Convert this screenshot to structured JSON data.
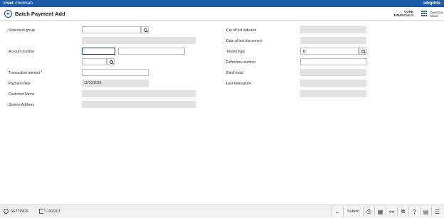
{
  "topbar": {
    "user_prefix": "User",
    "user_name": "cholman",
    "brand": "ubtpbta"
  },
  "header": {
    "title": "Batch Payment Add",
    "core_line1": "CORE",
    "core_line2": "FINANCIALS",
    "og_line1": "OpenGov",
    "og_line2": "Cloud"
  },
  "left": {
    "statement_group": {
      "label": "Statement group",
      "value": ""
    },
    "account_number": {
      "label": "Account number",
      "value": "",
      "value2": "",
      "value3": ""
    },
    "transaction_amount": {
      "label": "Transaction amount",
      "required_mark": "*",
      "value": ""
    },
    "payment_date": {
      "label": "Payment date",
      "value": "11/10/2021"
    },
    "customer_name": {
      "label": "Customer Name",
      "value": ""
    },
    "service_address": {
      "label": "Service Address",
      "value": ""
    }
  },
  "right": {
    "cutoff": {
      "label": "Cut off list indicator",
      "value": ""
    },
    "last_disconnect": {
      "label": "Date of last disconnect",
      "value": ""
    },
    "tender_type": {
      "label": "Tender type",
      "value": "K"
    },
    "reference_number": {
      "label": "Reference number",
      "value": ""
    },
    "batch_total": {
      "label": "Batch total",
      "value": ""
    },
    "last_transaction": {
      "label": "Last transaction",
      "value": ""
    }
  },
  "footer": {
    "settings": "SETTINGS",
    "logout": "LOGOUT",
    "submit": "Submit"
  }
}
